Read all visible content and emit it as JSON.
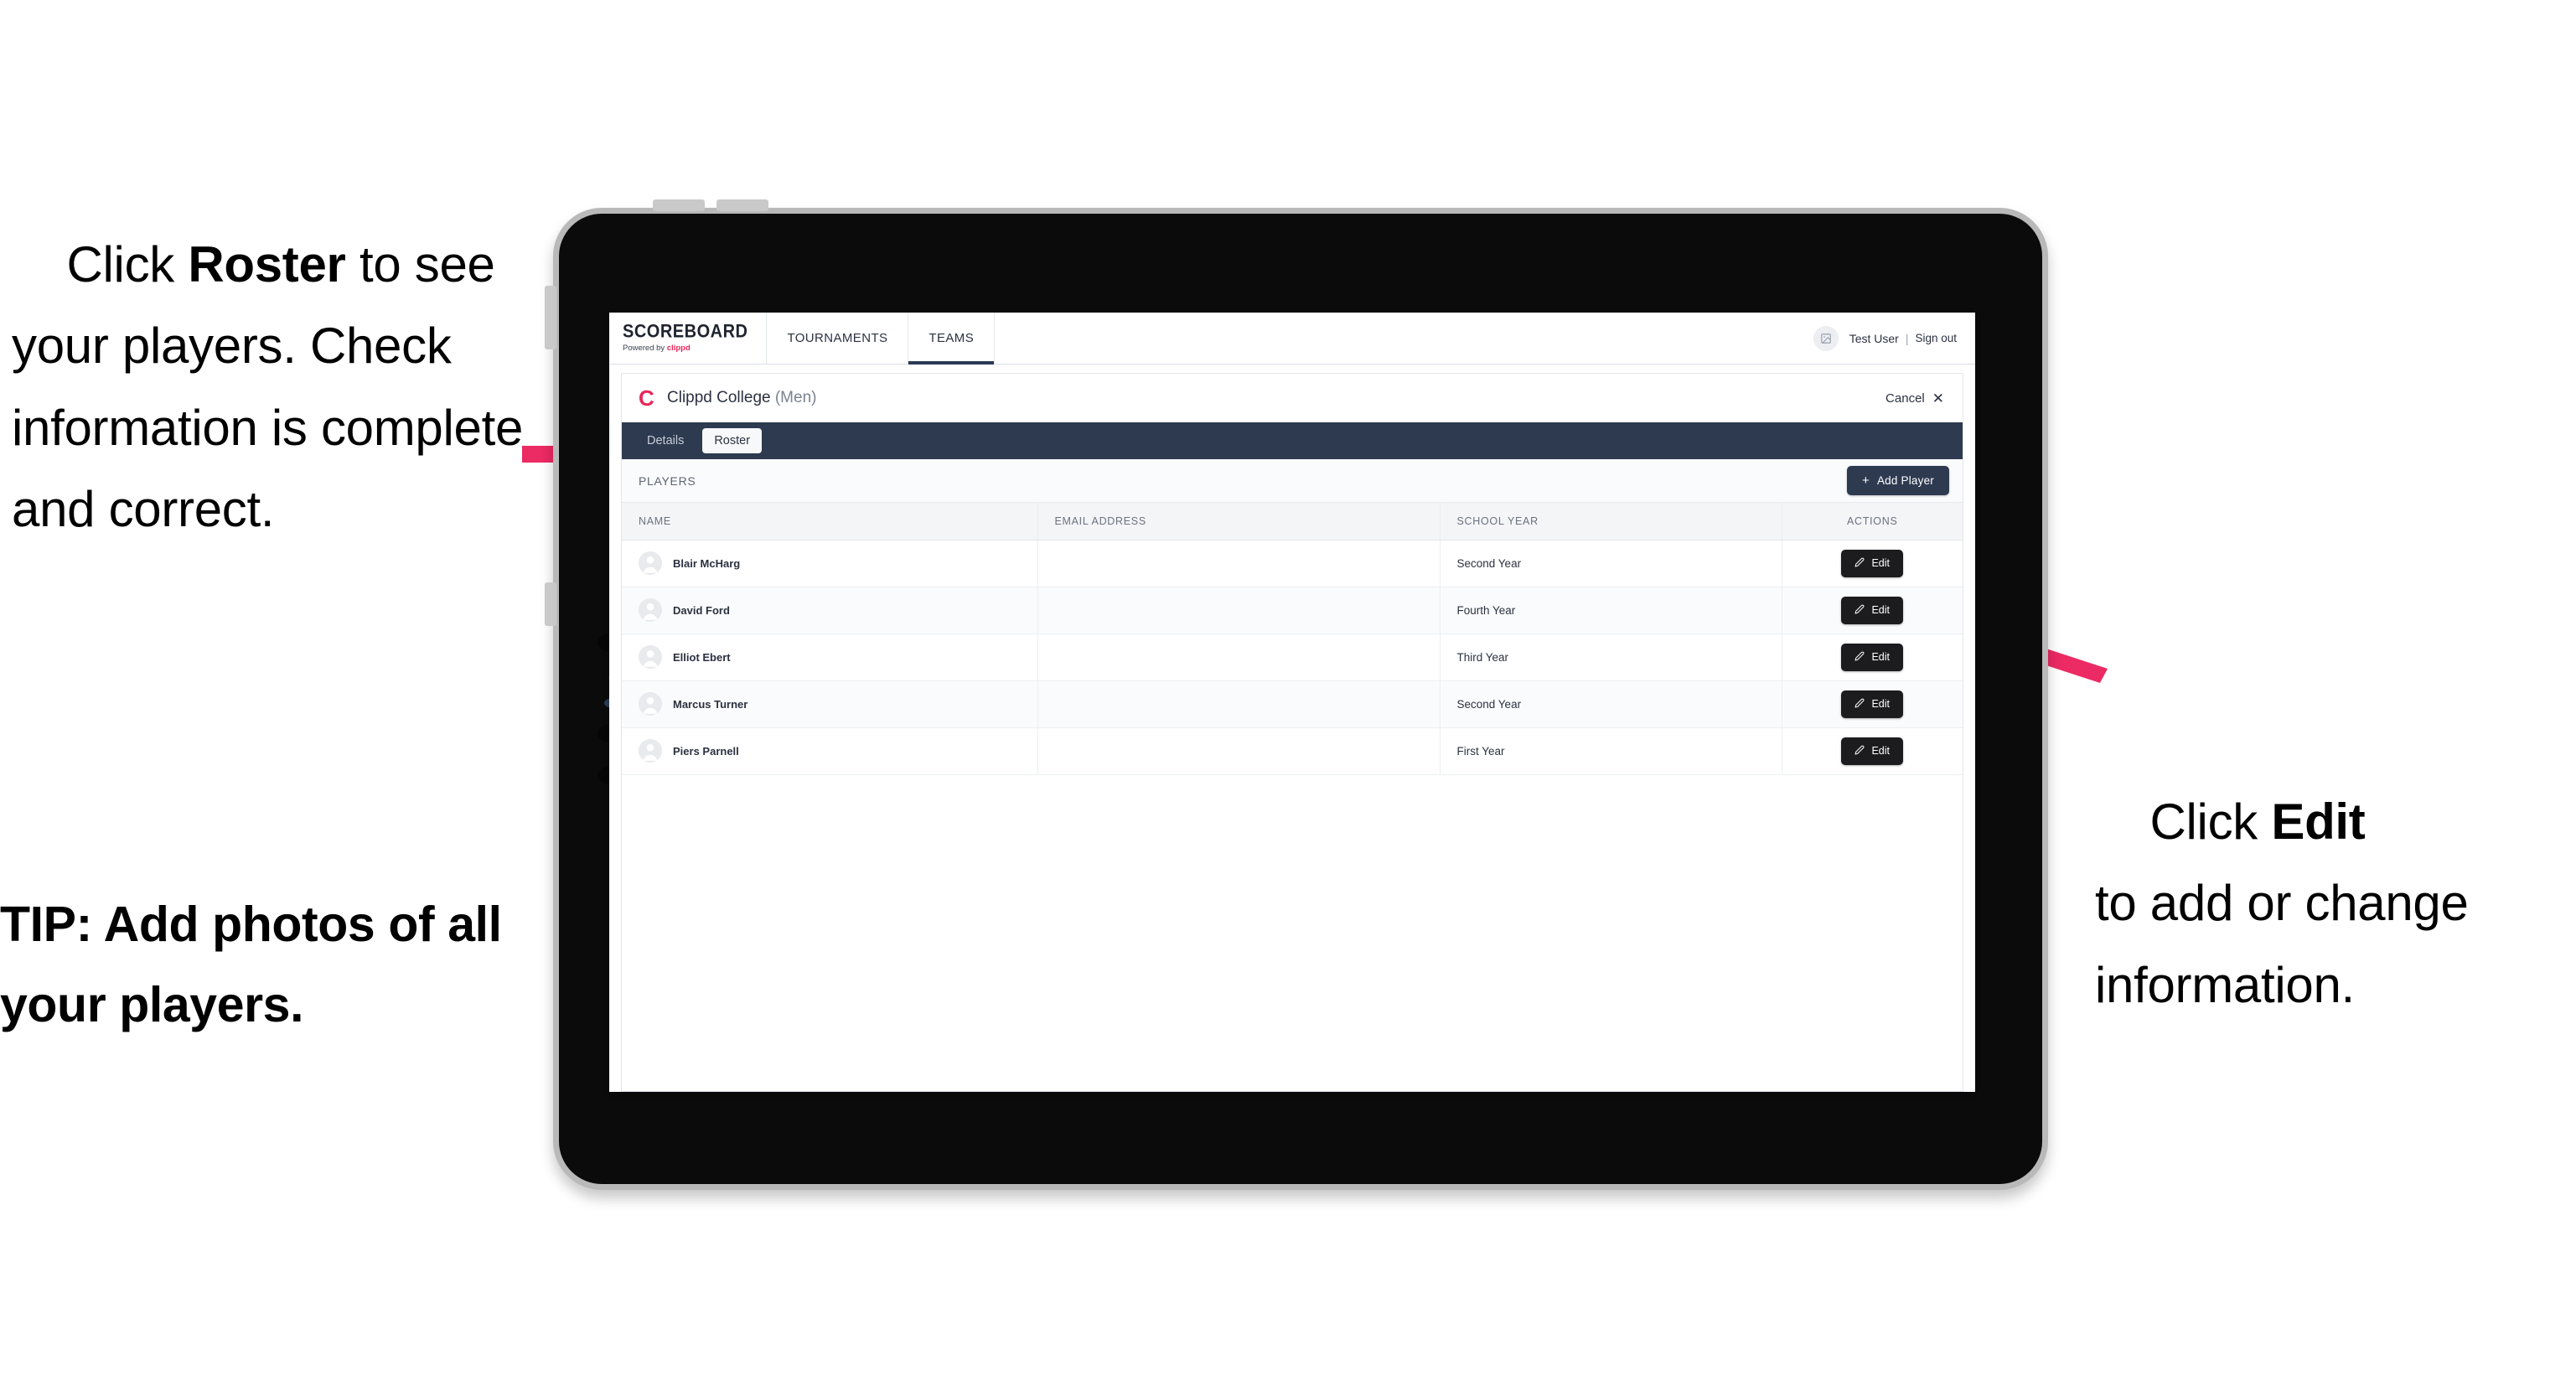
{
  "annotations": {
    "left_top": {
      "prefix": "Click ",
      "bold": "Roster",
      "suffix": " to see your players. Check information is complete and correct."
    },
    "left_bottom": {
      "text": "TIP: Add photos of all your players."
    },
    "right": {
      "prefix": "Click ",
      "bold": "Edit",
      "suffix": "\nto add or change information."
    },
    "arrow_color": "#ec2a63"
  },
  "app": {
    "topnav": {
      "brand_main": "SCOREBOARD",
      "brand_sub_prefix": "Powered by ",
      "brand_sub_clippd": "clippd",
      "tabs": [
        {
          "label": "TOURNAMENTS",
          "active": false
        },
        {
          "label": "TEAMS",
          "active": true
        }
      ],
      "user": {
        "avatar_icon": "image-placeholder-icon",
        "name": "Test User",
        "separator": "|",
        "sign_out": "Sign out"
      }
    },
    "team_card": {
      "logo_letter": "C",
      "logo_color": "#e8275a",
      "team_name": "Clippd College",
      "team_gender": "(Men)",
      "cancel_label": "Cancel",
      "cancel_icon": "close-x-icon",
      "tabs": [
        {
          "label": "Details",
          "selected": false
        },
        {
          "label": "Roster",
          "selected": true
        }
      ],
      "tabstrip_color": "#2d3a50"
    },
    "players_section": {
      "section_label": "PLAYERS",
      "add_player_label": "Add Player",
      "add_player_icon": "plus-icon",
      "columns": [
        "NAME",
        "EMAIL ADDRESS",
        "SCHOOL YEAR",
        "ACTIONS"
      ],
      "edit_label": "Edit",
      "edit_icon": "pencil-icon",
      "rows": [
        {
          "name": "Blair McHarg",
          "email": "",
          "school_year": "Second Year"
        },
        {
          "name": "David Ford",
          "email": "",
          "school_year": "Fourth Year"
        },
        {
          "name": "Elliot Ebert",
          "email": "",
          "school_year": "Third Year"
        },
        {
          "name": "Marcus Turner",
          "email": "",
          "school_year": "Second Year"
        },
        {
          "name": "Piers Parnell",
          "email": "",
          "school_year": "First Year"
        }
      ]
    }
  }
}
